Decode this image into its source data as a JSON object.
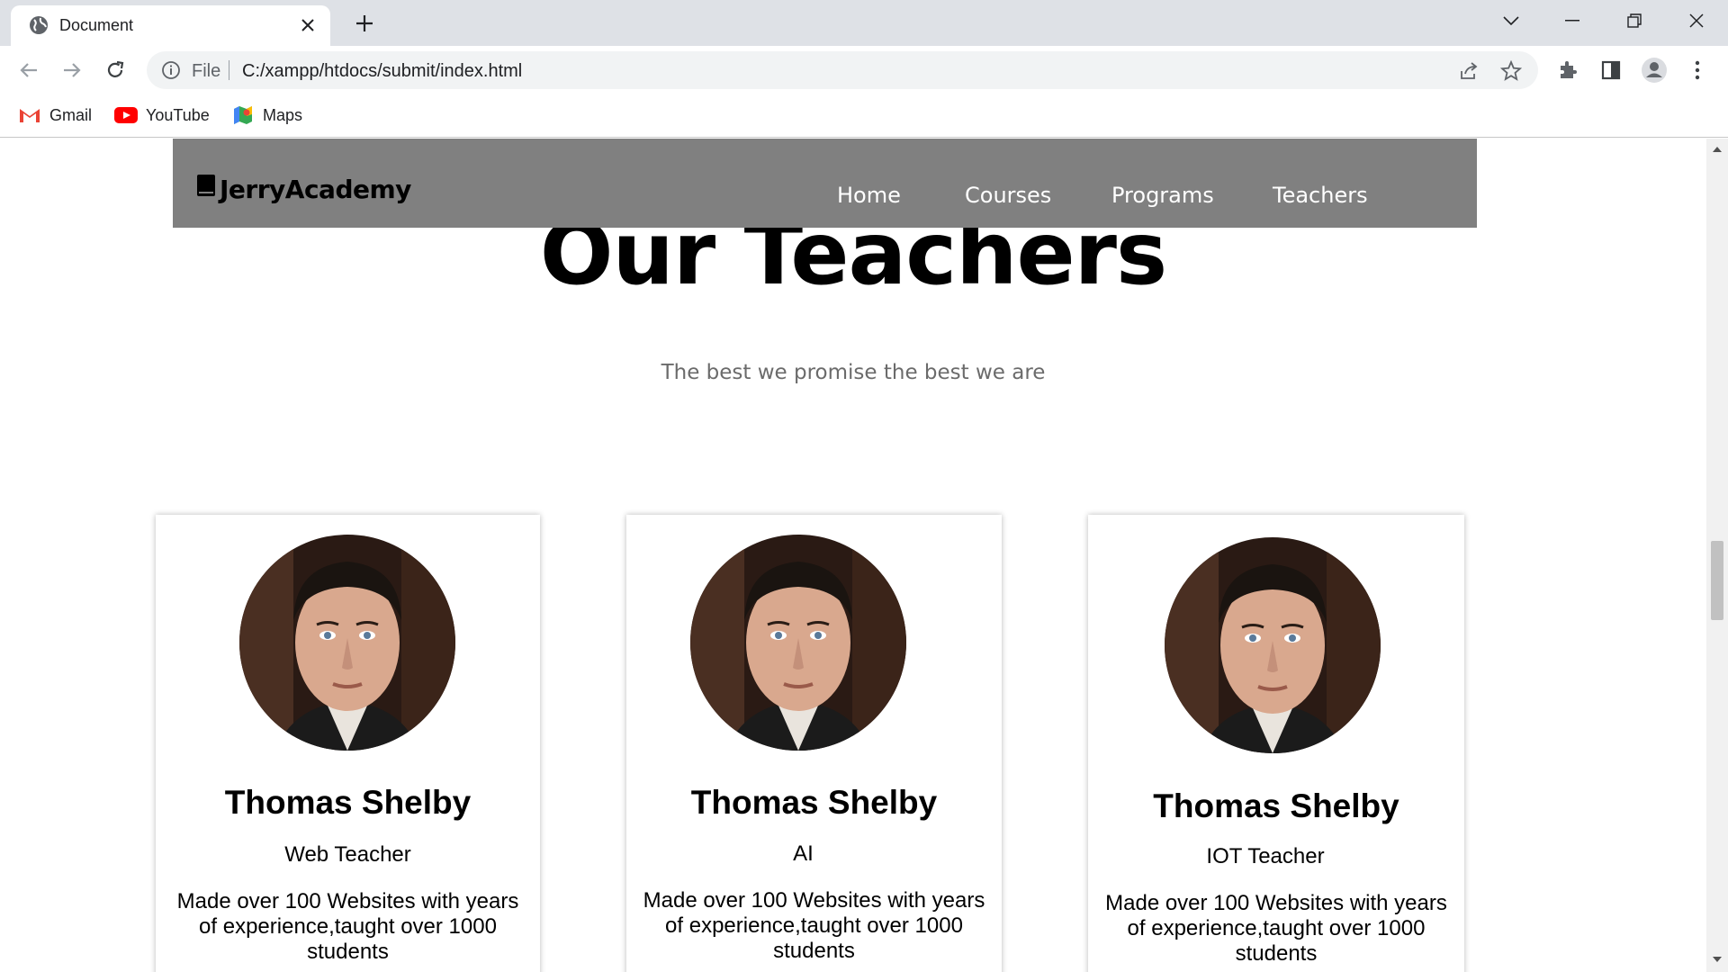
{
  "browser": {
    "tab_title": "Document",
    "omnibox_scheme": "File",
    "url": "C:/xampp/htdocs/submit/index.html",
    "bookmarks": [
      {
        "label": "Gmail",
        "icon": "gmail-icon"
      },
      {
        "label": "YouTube",
        "icon": "youtube-icon"
      },
      {
        "label": "Maps",
        "icon": "maps-icon"
      }
    ]
  },
  "site": {
    "brand": "JerryAcademy",
    "menu": [
      "Home",
      "Courses",
      "Programs",
      "Teachers"
    ],
    "heading": "Our Teachers",
    "subheading": "The best we promise the best we are",
    "teachers": [
      {
        "name": "Thomas Shelby",
        "role": "Web Teacher",
        "description": "Made over 100 Websites with years of experience,taught over 1000 students"
      },
      {
        "name": "Thomas Shelby",
        "role": "AI",
        "description": "Made over 100 Websites with years of experience,taught over 1000 students"
      },
      {
        "name": "Thomas Shelby",
        "role": "IOT Teacher",
        "description": "Made over 100 Websites with years of experience,taught over 1000 students"
      }
    ]
  },
  "colors": {
    "navbar": "#808080",
    "tabbar": "#dee1e6",
    "omnibox": "#f1f3f4",
    "subheading": "#6b6b6b"
  }
}
